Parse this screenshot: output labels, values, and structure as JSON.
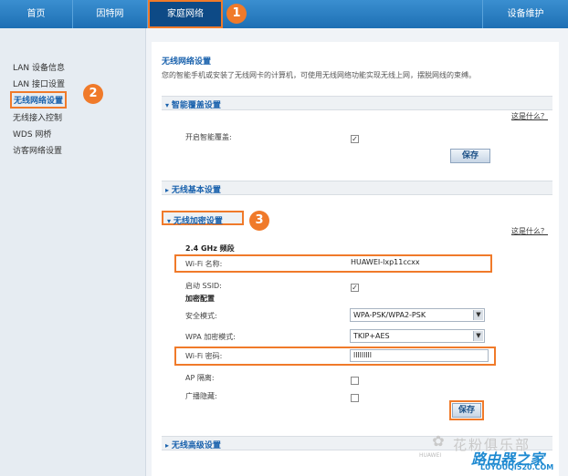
{
  "nav": {
    "home": "首页",
    "wan": "因特网",
    "home_network": "家庭网络",
    "maintenance": "设备维护"
  },
  "badges": [
    "1",
    "2",
    "3"
  ],
  "sidebar": {
    "items": [
      {
        "label": "LAN 设备信息"
      },
      {
        "label": "LAN 接口设置"
      },
      {
        "label": "无线网络设置"
      },
      {
        "label": "无线接入控制"
      },
      {
        "label": "WDS 网桥"
      },
      {
        "label": "访客网络设置"
      }
    ]
  },
  "main": {
    "title": "无线网络设置",
    "description": "您的智能手机或安装了无线网卡的计算机，可使用无线网络功能实现无线上网，摆脱网线的束缚。",
    "smart_coverage": {
      "header": "智能覆盖设置",
      "help_link": "这是什么？",
      "enable_label": "开启智能覆盖:",
      "enable_checked": "✓",
      "save_label": "保存"
    },
    "basic": {
      "header": "无线基本设置"
    },
    "encryption": {
      "header": "无线加密设置",
      "help_link": "这是什么？",
      "band_label": "2.4 GHz 频段",
      "ssid_name_label": "Wi-Fi 名称:",
      "ssid_name_value": "HUAWEI-lxp11ccxx",
      "enable_ssid_label": "启动 SSID:",
      "enable_ssid_checked": "✓",
      "encrypt_config_label": "加密配置",
      "security_mode_label": "安全模式:",
      "security_mode_value": "WPA-PSK/WPA2-PSK",
      "wpa_mode_label": "WPA 加密模式:",
      "wpa_mode_value": "TKIP+AES",
      "password_label": "Wi-Fi 密码:",
      "password_value": "lllllllll",
      "ap_isolation_label": "AP 隔离:",
      "broadcast_hide_label": "广播隐藏:",
      "save_label": "保存"
    },
    "advanced": {
      "header": "无线高级设置"
    }
  },
  "watermark": {
    "cn": "花粉俱乐部",
    "logo": "✿",
    "brand": "HUAWEI",
    "site": "路由器之家",
    "url": "LUYOUQI520.COM"
  },
  "colors": {
    "accent_orange": "#f07a2a",
    "nav_blue": "#1e6fb4",
    "link_blue": "#1a62ad"
  }
}
